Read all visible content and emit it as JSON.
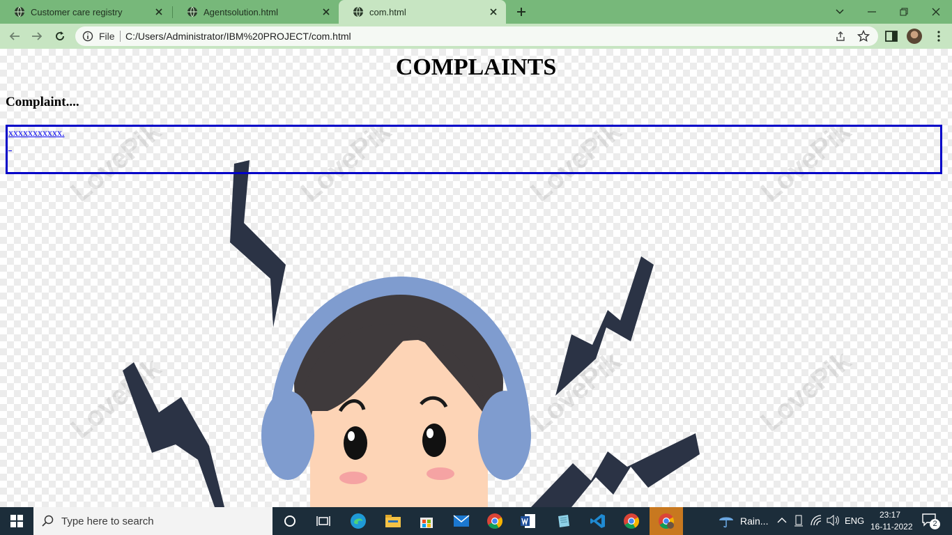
{
  "browser": {
    "tabs": [
      {
        "title": "Customer care registry",
        "active": false
      },
      {
        "title": "Agentsolution.html",
        "active": false
      },
      {
        "title": "com.html",
        "active": true
      }
    ],
    "address": {
      "scheme_label": "File",
      "url": "C:/Users/Administrator/IBM%20PROJECT/com.html"
    },
    "colors": {
      "tab_strip": "#77b87a",
      "toolbar": "#c7e5c2"
    }
  },
  "page": {
    "title": "COMPLAINTS",
    "subheading": "Complaint....",
    "complaint_link": "xxxxxxxxxxx.",
    "box_border_color": "#0000c8",
    "watermark": "LovePik"
  },
  "taskbar": {
    "search_placeholder": "Type here to search",
    "weather": "Rain...",
    "language": "ENG",
    "time": "23:17",
    "date": "16-11-2022",
    "notification_count": "2",
    "pinned_apps": [
      "task-view-icon",
      "edge-icon",
      "file-explorer-icon",
      "store-icon",
      "mail-icon",
      "chrome-icon",
      "word-icon",
      "notepad-icon",
      "vscode-icon",
      "chrome-icon",
      "chrome-profile-icon"
    ]
  }
}
